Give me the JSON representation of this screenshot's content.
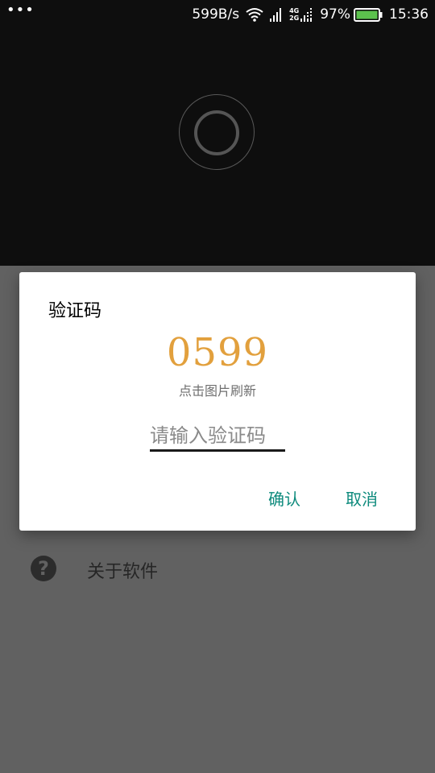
{
  "status_bar": {
    "menu_dots": "•••",
    "net_speed": "599B/s",
    "network_type_top": "4G",
    "network_type_bottom": "2G",
    "battery_percent": "97%",
    "time": "15:36",
    "icons": [
      "wifi-icon",
      "signal-icon",
      "dual-sim-signal-icon",
      "battery-icon"
    ]
  },
  "menu": {
    "about_label": "关于软件",
    "about_icon": "help-icon",
    "about_icon_glyph": "?"
  },
  "dialog": {
    "title": "验证码",
    "captcha_text": "0599",
    "refresh_hint": "点击图片刷新",
    "input_placeholder": "请输入验证码",
    "input_value": "",
    "confirm_label": "确认",
    "cancel_label": "取消"
  },
  "colors": {
    "accent": "#0d8a7c",
    "captcha": "#e2a03d",
    "overlay": "#616161",
    "header_bg": "#0e0e0e"
  }
}
